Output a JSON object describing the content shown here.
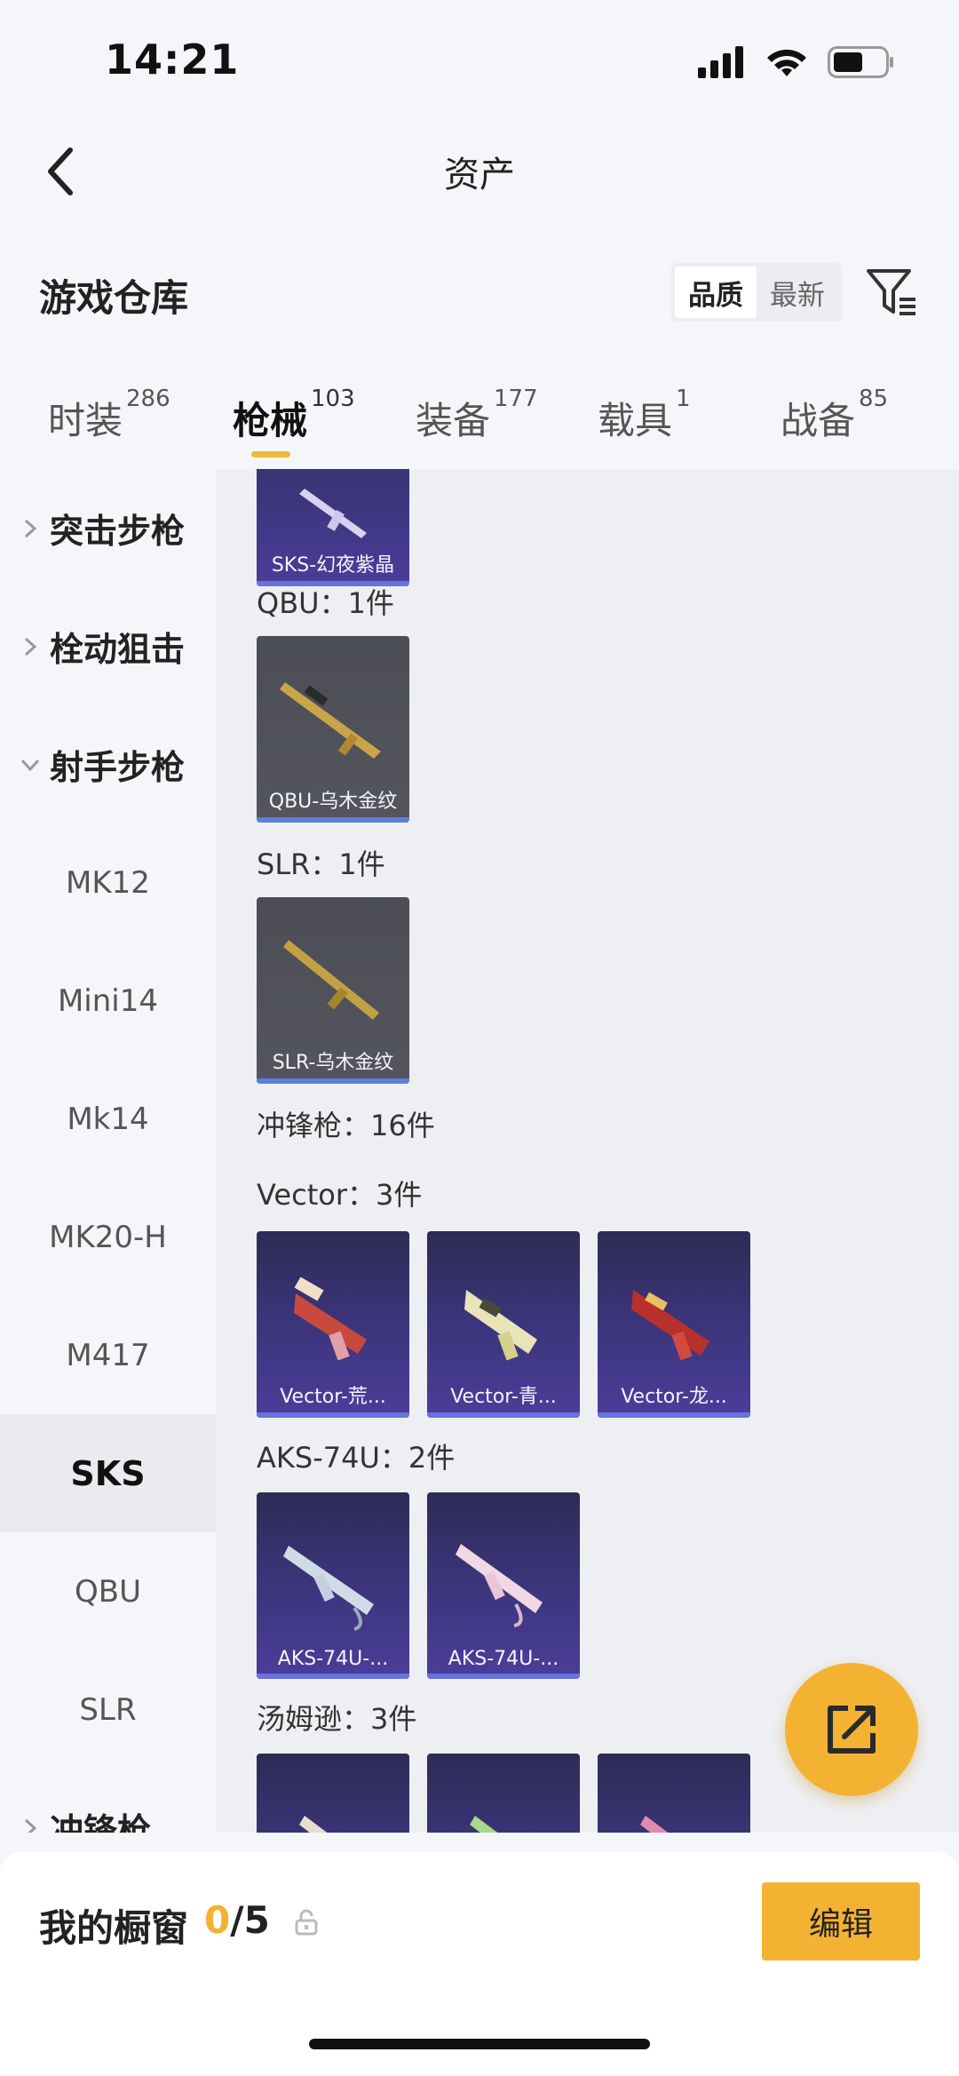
{
  "status": {
    "time": "14:21"
  },
  "nav": {
    "title": "资产"
  },
  "warehouse": {
    "title": "游戏仓库",
    "sort_quality": "品质",
    "sort_latest": "最新"
  },
  "tabs": [
    {
      "label": "时装",
      "count": "286"
    },
    {
      "label": "枪械",
      "count": "103"
    },
    {
      "label": "装备",
      "count": "177"
    },
    {
      "label": "载具",
      "count": "1"
    },
    {
      "label": "战备",
      "count": "85"
    }
  ],
  "sidebar": {
    "categories": [
      "突击步枪",
      "栓动狙击",
      "射手步枪",
      "冲锋枪"
    ],
    "subitems": [
      "MK12",
      "Mini14",
      "Mk14",
      "MK20-H",
      "M417",
      "SKS",
      "QBU",
      "SLR"
    ]
  },
  "content": {
    "sections": [
      "QBU：1件",
      "SLR：1件",
      "冲锋枪：16件",
      "Vector：3件",
      "AKS-74U：2件",
      "汤姆逊：3件"
    ],
    "cards": [
      "SKS-幻夜紫晶",
      "QBU-乌木金纹",
      "SLR-乌木金纹",
      "Vector-荒...",
      "Vector-青...",
      "Vector-龙...",
      "AKS-74U-...",
      "AKS-74U-..."
    ]
  },
  "showcase": {
    "label": "我的橱窗",
    "current": "0",
    "total": "/5",
    "edit_label": "编辑"
  },
  "colors": {
    "accent": "#f3b232",
    "card_purple": "#3a3478",
    "card_gray": "#4c4d55"
  }
}
